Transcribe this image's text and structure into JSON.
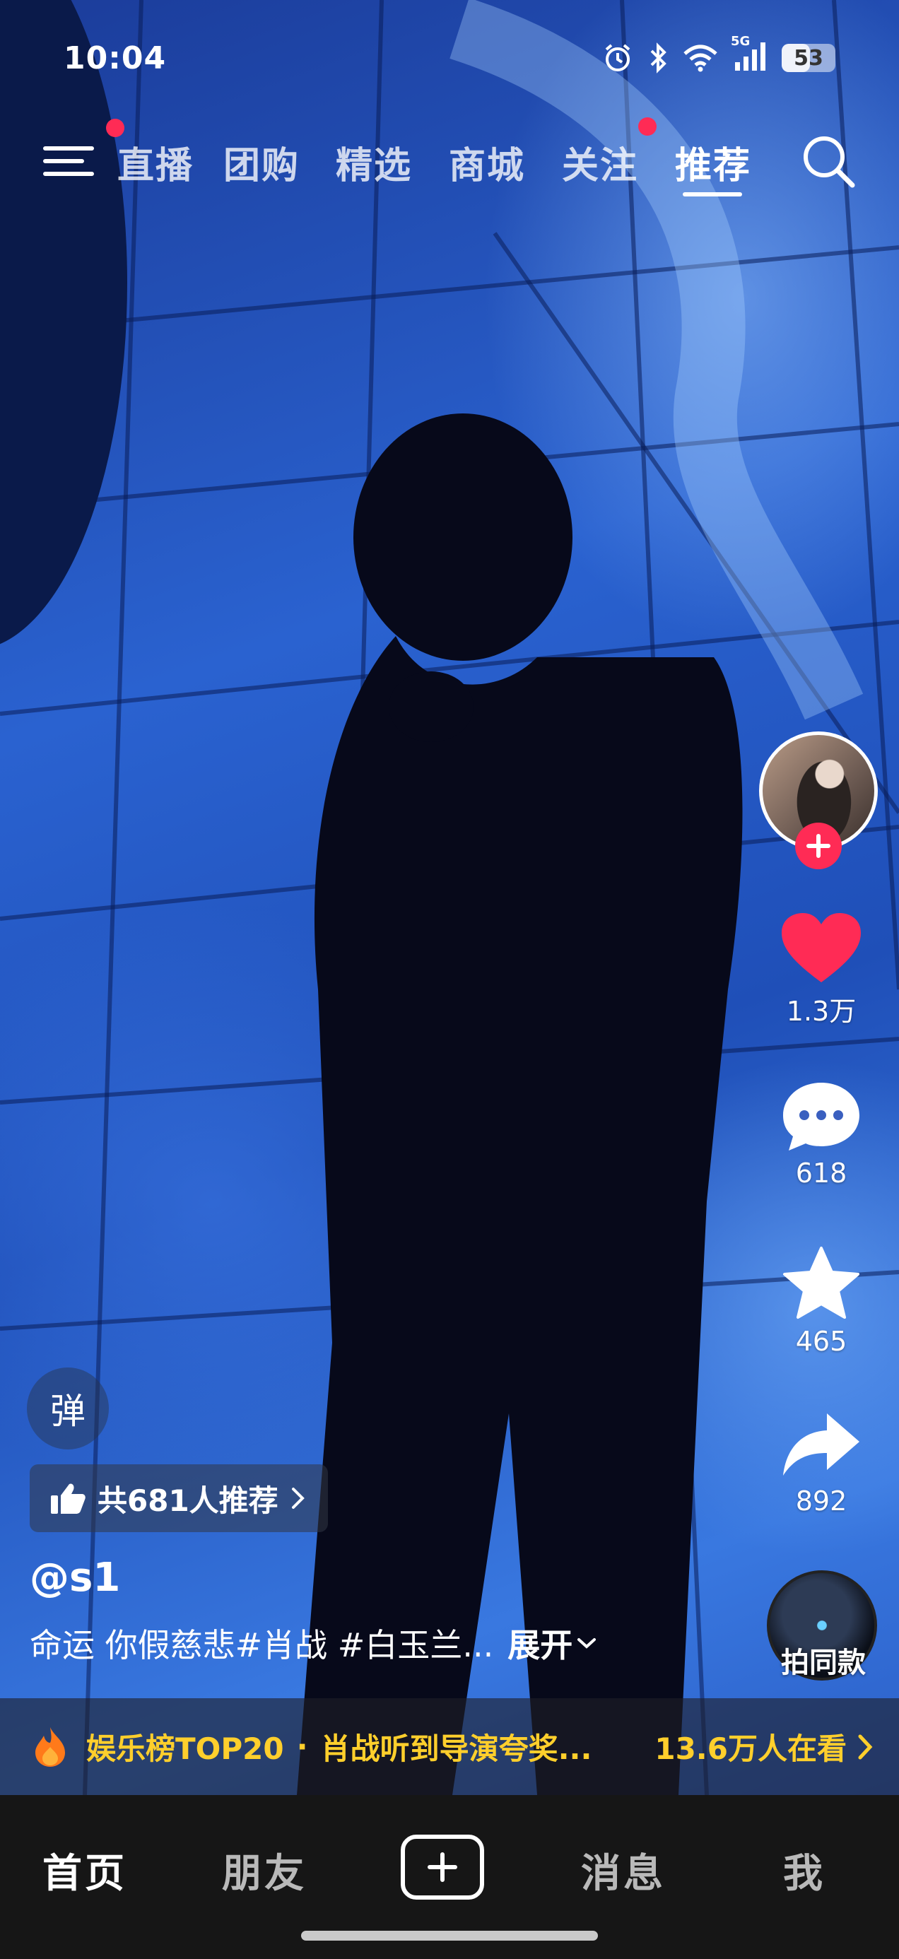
{
  "status_bar": {
    "time": "10:04",
    "network": "5G",
    "battery": 53,
    "battery_label": "53",
    "icons": [
      "alarm-icon",
      "bluetooth-icon",
      "wifi-icon",
      "cellular-5g-icon",
      "battery-icon"
    ]
  },
  "top_nav": {
    "menu_icon": "hamburger-menu-icon",
    "tabs": [
      {
        "label": "直播",
        "badge": false
      },
      {
        "label": "团购",
        "badge": false
      },
      {
        "label": "精选",
        "badge": false
      },
      {
        "label": "商城",
        "badge": false
      },
      {
        "label": "关注",
        "badge": true
      },
      {
        "label": "推荐",
        "badge": false,
        "active": true
      }
    ],
    "menu_badge": true,
    "search_icon": "search-icon"
  },
  "actions": {
    "follow_icon": "plus-icon",
    "like_count": "1.3万",
    "comment_count": "618",
    "favorite_count": "465",
    "share_count": "892",
    "same_style_label": "拍同款"
  },
  "video_info": {
    "danmu_label": "弹",
    "recommend_label": "共681人推荐",
    "username": "@s1",
    "caption": "命运 你假慈悲#肖战 #白玉兰...",
    "expand_label": "展开"
  },
  "hot_banner": {
    "rank_label": "娱乐榜TOP20",
    "separator": "·",
    "headline": "肖战听到导演夸奖...",
    "viewers": "13.6万人在看"
  },
  "bottom_nav": {
    "tabs": [
      {
        "label": "首页",
        "active": true
      },
      {
        "label": "朋友",
        "active": false
      },
      {
        "label": "消息",
        "active": false
      },
      {
        "label": "我",
        "active": false
      }
    ],
    "create_icon": "plus-icon"
  },
  "colors": {
    "accent_red": "#ff2b55",
    "hot_yellow": "#ffcf2c",
    "bottom_bar": "#161616"
  }
}
